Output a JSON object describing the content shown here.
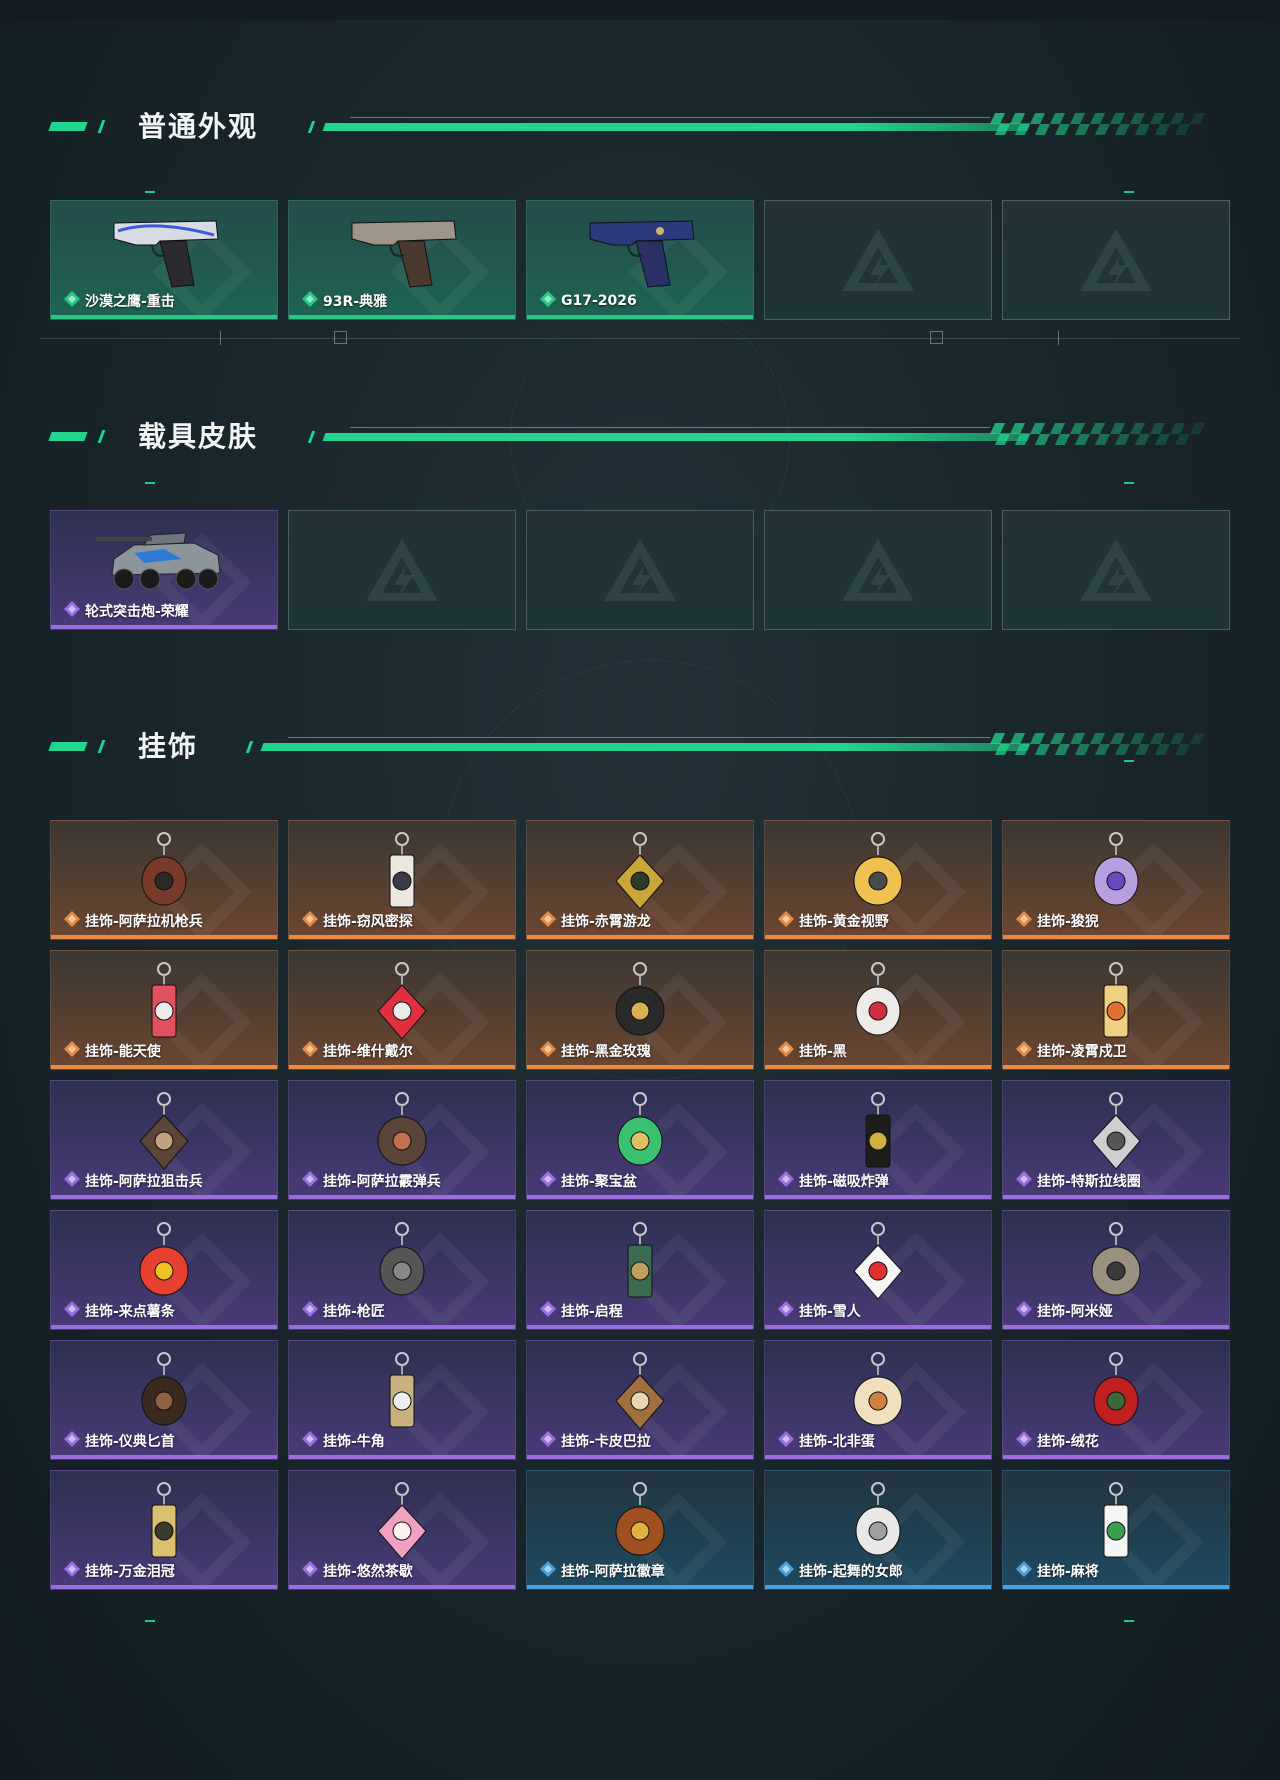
{
  "colors": {
    "green": "#22d58f",
    "rarity_green": "#27c886",
    "rarity_purple": "#9a6ee0",
    "rarity_orange": "#e88a44",
    "rarity_blue": "#4aa1e0"
  },
  "sections": [
    {
      "title": "普通外观",
      "items": [
        {
          "label": "沙漠之鹰-重击",
          "rarity": "green",
          "icon": "pistol-desert-eagle-icon"
        },
        {
          "label": "93R-典雅",
          "rarity": "green",
          "icon": "pistol-93r-icon"
        },
        {
          "label": "G17-2026",
          "rarity": "green",
          "icon": "pistol-g17-icon"
        },
        {
          "label": "",
          "rarity": "empty",
          "icon": "empty-slot-logo-icon"
        },
        {
          "label": "",
          "rarity": "empty",
          "icon": "empty-slot-logo-icon"
        }
      ]
    },
    {
      "title": "载具皮肤",
      "items": [
        {
          "label": "轮式突击炮-荣耀",
          "rarity": "purple",
          "icon": "vehicle-icon"
        },
        {
          "label": "",
          "rarity": "empty",
          "icon": "empty-slot-logo-icon"
        },
        {
          "label": "",
          "rarity": "empty",
          "icon": "empty-slot-logo-icon"
        },
        {
          "label": "",
          "rarity": "empty",
          "icon": "empty-slot-logo-icon"
        },
        {
          "label": "",
          "rarity": "empty",
          "icon": "empty-slot-logo-icon"
        }
      ]
    },
    {
      "title": "挂饰",
      "items": [
        {
          "label": "挂饰-阿萨拉机枪兵",
          "rarity": "orange",
          "icon": "charm-icon"
        },
        {
          "label": "挂饰-窃风密探",
          "rarity": "orange",
          "icon": "charm-icon"
        },
        {
          "label": "挂饰-赤霄游龙",
          "rarity": "orange",
          "icon": "charm-icon"
        },
        {
          "label": "挂饰-黄金视野",
          "rarity": "orange",
          "icon": "charm-icon"
        },
        {
          "label": "挂饰-狻猊",
          "rarity": "orange",
          "icon": "charm-icon"
        },
        {
          "label": "挂饰-能天使",
          "rarity": "orange",
          "icon": "charm-icon"
        },
        {
          "label": "挂饰-维什戴尔",
          "rarity": "orange",
          "icon": "charm-icon"
        },
        {
          "label": "挂饰-黑金玫瑰",
          "rarity": "orange",
          "icon": "charm-icon"
        },
        {
          "label": "挂饰-黑",
          "rarity": "orange",
          "icon": "charm-icon"
        },
        {
          "label": "挂饰-凌霄戍卫",
          "rarity": "orange",
          "icon": "charm-icon"
        },
        {
          "label": "挂饰-阿萨拉狙击兵",
          "rarity": "purple",
          "icon": "charm-icon"
        },
        {
          "label": "挂饰-阿萨拉霰弹兵",
          "rarity": "purple",
          "icon": "charm-icon"
        },
        {
          "label": "挂饰-聚宝盆",
          "rarity": "purple",
          "icon": "charm-icon"
        },
        {
          "label": "挂饰-磁吸炸弹",
          "rarity": "purple",
          "icon": "charm-icon"
        },
        {
          "label": "挂饰-特斯拉线圈",
          "rarity": "purple",
          "icon": "charm-icon"
        },
        {
          "label": "挂饰-来点薯条",
          "rarity": "purple",
          "icon": "charm-icon"
        },
        {
          "label": "挂饰-枪匠",
          "rarity": "purple",
          "icon": "charm-icon"
        },
        {
          "label": "挂饰-启程",
          "rarity": "purple",
          "icon": "charm-icon"
        },
        {
          "label": "挂饰-雪人",
          "rarity": "purple",
          "icon": "charm-icon"
        },
        {
          "label": "挂饰-阿米娅",
          "rarity": "purple",
          "icon": "charm-icon"
        },
        {
          "label": "挂饰-仪典匕首",
          "rarity": "purple",
          "icon": "charm-icon"
        },
        {
          "label": "挂饰-牛角",
          "rarity": "purple",
          "icon": "charm-icon"
        },
        {
          "label": "挂饰-卡皮巴拉",
          "rarity": "purple",
          "icon": "charm-icon"
        },
        {
          "label": "挂饰-北非蛋",
          "rarity": "purple",
          "icon": "charm-icon"
        },
        {
          "label": "挂饰-绒花",
          "rarity": "purple",
          "icon": "charm-icon"
        },
        {
          "label": "挂饰-万金泪冠",
          "rarity": "purple",
          "icon": "charm-icon"
        },
        {
          "label": "挂饰-悠然茶歇",
          "rarity": "purple",
          "icon": "charm-icon"
        },
        {
          "label": "挂饰-阿萨拉徽章",
          "rarity": "blue",
          "icon": "charm-icon"
        },
        {
          "label": "挂饰-起舞的女郎",
          "rarity": "blue",
          "icon": "charm-icon"
        },
        {
          "label": "挂饰-麻将",
          "rarity": "blue",
          "icon": "charm-icon"
        }
      ]
    }
  ]
}
